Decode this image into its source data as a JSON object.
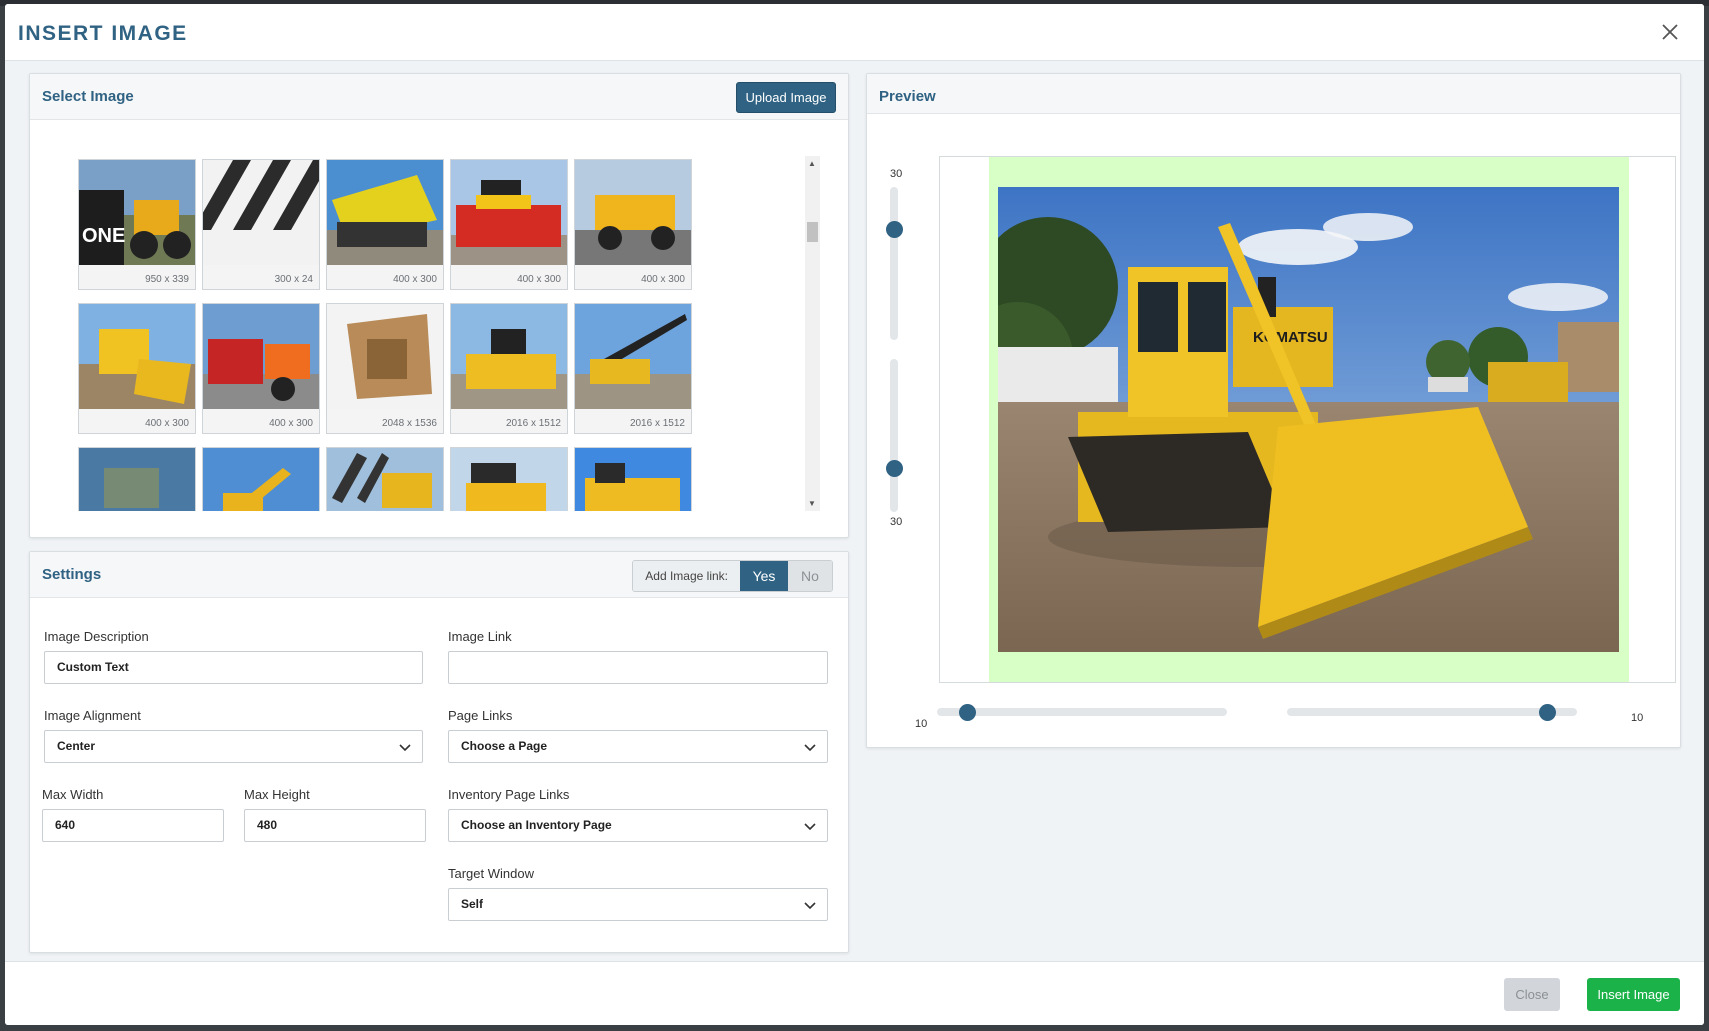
{
  "modal": {
    "title": "INSERT IMAGE"
  },
  "select_image": {
    "title": "Select Image",
    "upload_label": "Upload Image",
    "thumbnails": [
      {
        "size": "950 x 339"
      },
      {
        "size": "300 x 24"
      },
      {
        "size": "400 x 300"
      },
      {
        "size": "400 x 300"
      },
      {
        "size": "400 x 300"
      },
      {
        "size": "400 x 300"
      },
      {
        "size": "400 x 300"
      },
      {
        "size": "2048 x 1536"
      },
      {
        "size": "2016 x 1512"
      },
      {
        "size": "2016 x 1512"
      }
    ]
  },
  "settings": {
    "title": "Settings",
    "add_image_link_label": "Add Image link:",
    "yes_label": "Yes",
    "no_label": "No",
    "image_description_label": "Image Description",
    "image_description_value": "Custom Text",
    "image_link_label": "Image Link",
    "image_link_value": "",
    "image_alignment_label": "Image Alignment",
    "image_alignment_value": "Center",
    "page_links_label": "Page Links",
    "page_links_value": "Choose a Page",
    "max_width_label": "Max Width",
    "max_width_value": "640",
    "max_height_label": "Max Height",
    "max_height_value": "480",
    "inventory_links_label": "Inventory Page Links",
    "inventory_links_value": "Choose an Inventory Page",
    "target_window_label": "Target Window",
    "target_window_value": "Self"
  },
  "preview": {
    "title": "Preview",
    "top_margin": "30",
    "bottom_margin": "30",
    "left_margin": "10",
    "right_margin": "10"
  },
  "footer": {
    "close_label": "Close",
    "insert_label": "Insert Image"
  },
  "colors": {
    "brand": "#2f6283",
    "insert": "#1cb24a",
    "preview_bg": "#d8ffc6"
  }
}
